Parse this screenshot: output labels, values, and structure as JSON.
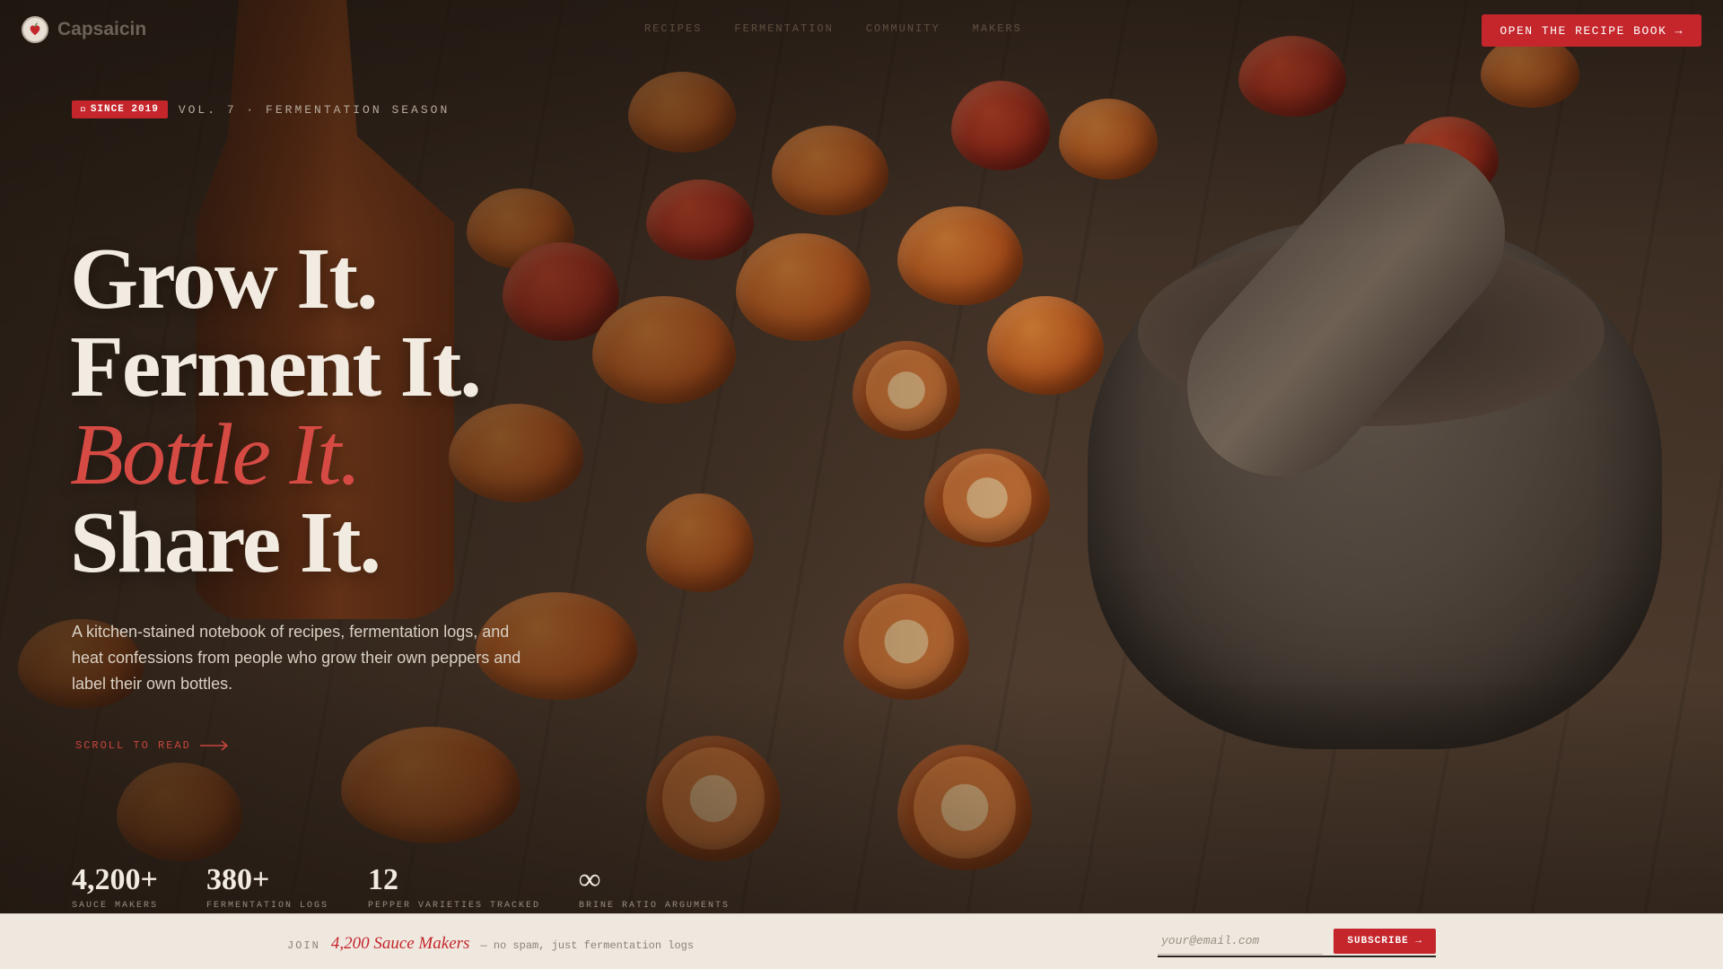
{
  "brand": {
    "name": "Capsaicin",
    "logo_icon": "pepper-heart-icon"
  },
  "nav": {
    "links": [
      "RECIPES",
      "FERMENTATION",
      "COMMUNITY",
      "MAKERS"
    ],
    "cta_label": "OPEN THE RECIPE BOOK →"
  },
  "hero": {
    "badge": "SINCE 2019",
    "badge_icon": "seal-dot-icon",
    "volume": "VOL. 7 · FERMENTATION SEASON",
    "headline": [
      "Grow It.",
      "Ferment It.",
      "Bottle It.",
      "Share It."
    ],
    "lede": "A kitchen-stained notebook of recipes, fermentation logs, and heat confessions from people who grow their own peppers and label their own bottles.",
    "scroll_label": "SCROLL TO READ"
  },
  "stats": [
    {
      "value": "4,200+",
      "label": "SAUCE MAKERS"
    },
    {
      "value": "380+",
      "label": "FERMENTATION LOGS"
    },
    {
      "value": "12",
      "label": "PEPPER VARIETIES TRACKED"
    },
    {
      "value": "∞",
      "label": "BRINE RATIO ARGUMENTS"
    }
  ],
  "newsletter": {
    "join_label": "JOIN",
    "count": "4,200 Sauce Makers",
    "note": "— no spam, just fermentation logs",
    "placeholder": "your@email.com",
    "value": "",
    "button_label": "SUBSCRIBE →"
  },
  "colors": {
    "accent": "#c4262c",
    "headline": "#f2ebe1",
    "bar_bg": "#efe8df"
  }
}
